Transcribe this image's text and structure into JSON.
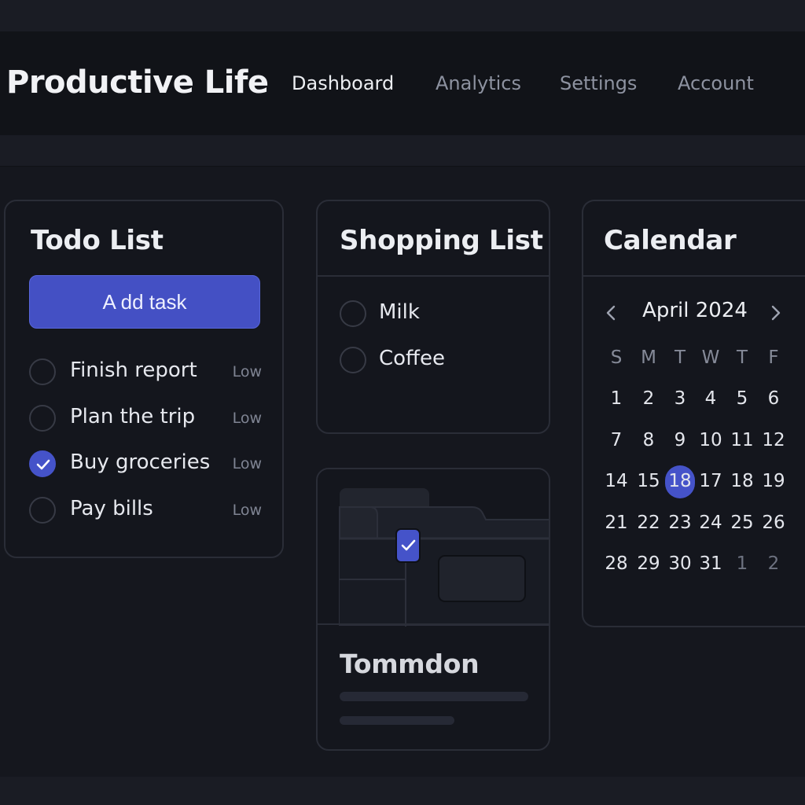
{
  "app": {
    "title": "Productive Life",
    "nav": [
      {
        "label": "Dashboard",
        "active": true
      },
      {
        "label": "Analytics",
        "active": false
      },
      {
        "label": "Settings",
        "active": false
      },
      {
        "label": "Account",
        "active": false
      }
    ]
  },
  "todo": {
    "title": "Todo List",
    "add_label": "A dd task",
    "tasks": [
      {
        "label": "Finish report",
        "priority": "Low",
        "done": false
      },
      {
        "label": "Plan the trip",
        "priority": "Low",
        "done": false
      },
      {
        "label": "Buy groceries",
        "priority": "Low",
        "done": true
      },
      {
        "label": "Pay bills",
        "priority": "Low",
        "done": false
      }
    ]
  },
  "shopping": {
    "title": "Shopping List",
    "items": [
      {
        "label": "Milk",
        "done": false
      },
      {
        "label": "Coffee",
        "done": false
      }
    ]
  },
  "calendar": {
    "title": "Calendar",
    "month": "April 2024",
    "weekdays": [
      "S",
      "M",
      "T",
      "W",
      "T",
      "F"
    ],
    "weeks": [
      [
        "1",
        "2",
        "3",
        "4",
        "5",
        "6"
      ],
      [
        "7",
        "8",
        "9",
        "10",
        "11",
        "12"
      ],
      [
        "14",
        "15",
        "18",
        "17",
        "18",
        "19"
      ],
      [
        "21",
        "22",
        "23",
        "24",
        "25",
        "26"
      ],
      [
        "28",
        "29",
        "30",
        "31",
        "1",
        "2"
      ]
    ],
    "selected": {
      "week": 2,
      "day": 2
    },
    "muted_days": [
      {
        "week": 4,
        "day": 4
      },
      {
        "week": 4,
        "day": 5
      }
    ]
  },
  "project": {
    "title": "Tommdon"
  },
  "colors": {
    "accent": "#4553c9",
    "background": "#15171e",
    "card": "#14161d",
    "border": "#2a2d37"
  },
  "icons": {
    "check": "check-icon",
    "prev": "chevron-left-icon",
    "next": "chevron-right-icon"
  }
}
